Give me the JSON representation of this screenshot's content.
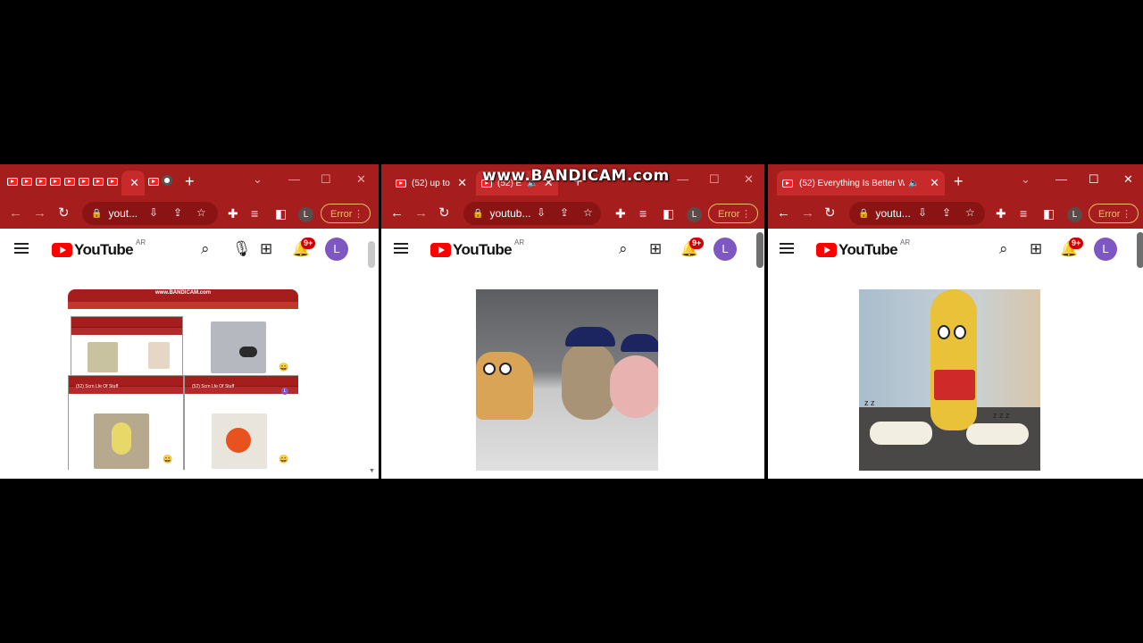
{
  "watermark": "www.BANDICAM.com",
  "colors": {
    "chrome": "#a51d1d",
    "accent": "#ff0000",
    "avatar": "#7e57c2",
    "error": "#f4c06a"
  },
  "window1": {
    "url": "yout...",
    "error_label": "Error",
    "profile_initial": "L",
    "yt": {
      "logo": "YouTube",
      "region": "AR",
      "notif_badge": "9+",
      "avatar_initial": "L"
    },
    "thumbnail": {
      "watermark": "www.BANDICAM.com",
      "inner_avatar": "L",
      "inner_tab": "(52) Scrn Lfe Of Stuff"
    }
  },
  "window2": {
    "tabs": [
      {
        "title": "(52) up to",
        "icon": "youtube-favicon"
      },
      {
        "title": "(52) E",
        "icon": "youtube-favicon",
        "muted_icon": "speaker-icon"
      }
    ],
    "url": "youtub...",
    "error_label": "Error",
    "profile_initial": "L",
    "yt": {
      "logo": "YouTube",
      "region": "AR",
      "notif_badge": "9+",
      "avatar_initial": "L"
    }
  },
  "window3": {
    "tabs": [
      {
        "title": "(52) Everything Is Better W",
        "icon": "youtube-favicon",
        "muted_icon": "speaker-icon"
      }
    ],
    "url": "youtu...",
    "error_label": "Error",
    "profile_initial": "L",
    "yt": {
      "logo": "YouTube",
      "region": "AR",
      "notif_badge": "9+",
      "avatar_initial": "L"
    }
  }
}
